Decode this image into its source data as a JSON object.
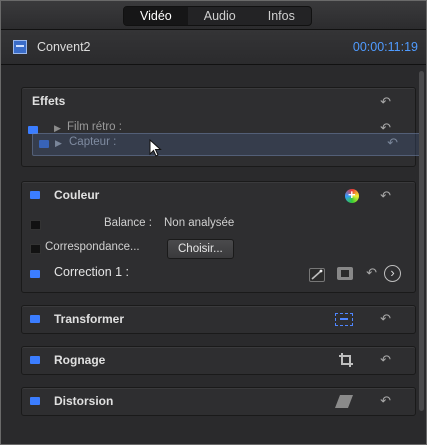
{
  "tabs": [
    "Vidéo",
    "Audio",
    "Infos"
  ],
  "clip": {
    "name": "Convent2",
    "timecode": "00:00:11:19"
  },
  "effets": {
    "title": "Effets",
    "items": [
      {
        "label": "Film rétro :"
      },
      {
        "label": "Capteur :"
      }
    ]
  },
  "couleur": {
    "title": "Couleur",
    "balance_label": "Balance :",
    "balance_value": "Non analysée",
    "correspondance_label": "Correspondance...",
    "choose_button": "Choisir...",
    "correction_label": "Correction 1 :"
  },
  "transformer": {
    "title": "Transformer"
  },
  "rognage": {
    "title": "Rognage"
  },
  "distorsion": {
    "title": "Distorsion"
  },
  "icons": {
    "undo": "↶",
    "disclosure": "▶",
    "add_color": "+",
    "next": "›"
  },
  "colors": {
    "accent_blue": "#3b7dff",
    "timecode": "#4f9bff"
  }
}
